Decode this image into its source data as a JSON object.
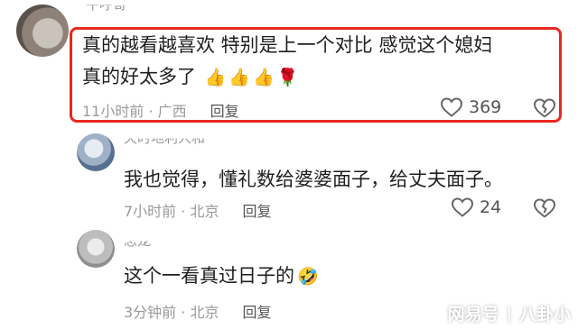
{
  "comments": [
    {
      "author": "牛呼哥",
      "text_line1": "真的越看越喜欢 特别是上一个对比 感觉这个媳妇",
      "text_line2": "真的好太多了",
      "time_location": "11小时前 · 广西",
      "reply_label": "回复",
      "likes": "369",
      "emojis": [
        "thumbs-up",
        "thumbs-up",
        "thumbs-up",
        "rose"
      ]
    },
    {
      "author": "天时地利人和",
      "text": "我也觉得，懂礼数给婆婆面子，给丈夫面子。",
      "time_location": "7小时前 · 北京",
      "reply_label": "回复",
      "likes": "24"
    },
    {
      "author": "思龙",
      "text": "这个一看真过日子的",
      "emoji": "laughing-crying",
      "time_location": "3分钟前 · 北京",
      "reply_label": "回复"
    }
  ],
  "watermark": {
    "left": "网易号",
    "right": "八卦小"
  },
  "colors": {
    "highlight_border": "#e8281f",
    "meta": "#9a9a9a"
  }
}
